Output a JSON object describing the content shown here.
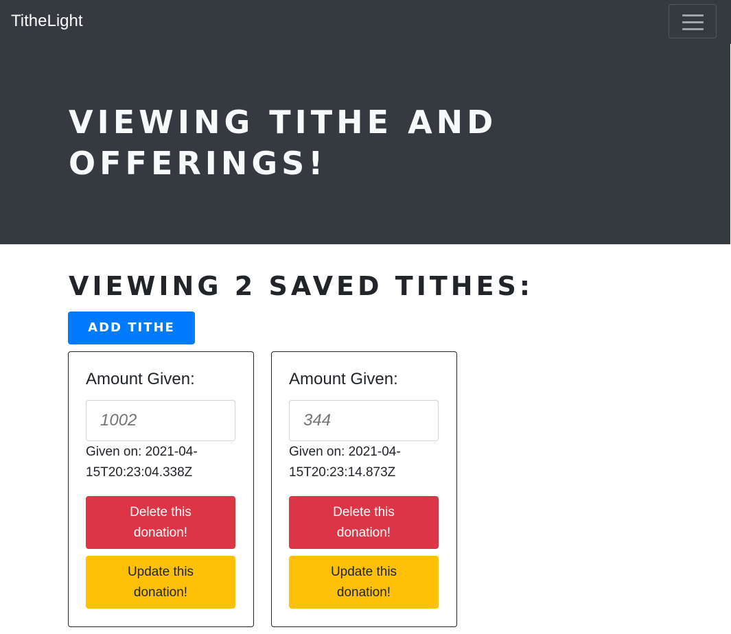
{
  "navbar": {
    "brand": "TitheLight",
    "toggler_icon": "hamburger-icon"
  },
  "hero": {
    "title": "Viewing Tithe and Offerings!"
  },
  "main": {
    "section_title": "Viewing 2 saved tithes:",
    "add_button": "Add Tithe",
    "cards": [
      {
        "amount_label": "Amount Given:",
        "amount_placeholder": "1002",
        "given_on": "Given on: 2021-04-15T20:23:04.338Z",
        "delete_label": "Delete this donation!",
        "update_label": "Update this donation!"
      },
      {
        "amount_label": "Amount Given:",
        "amount_placeholder": "344",
        "given_on": "Given on: 2021-04-15T20:23:14.873Z",
        "delete_label": "Delete this donation!",
        "update_label": "Update this donation!"
      }
    ]
  },
  "colors": {
    "dark": "#343a40",
    "primary": "#007bff",
    "danger": "#dc3545",
    "warning": "#ffc107"
  }
}
